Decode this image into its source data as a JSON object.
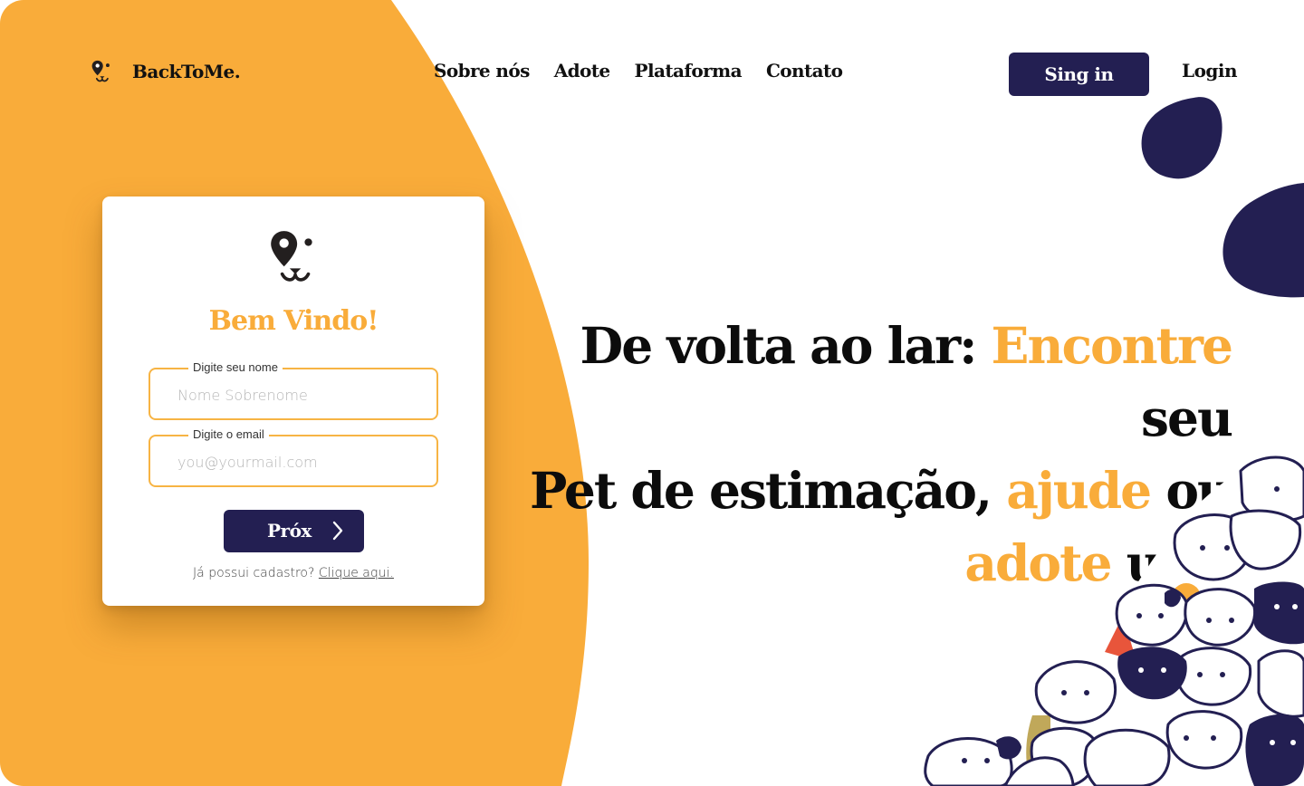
{
  "colors": {
    "accent": "#f9ac3a",
    "primary": "#231f52",
    "text": "#0c0c0c"
  },
  "header": {
    "brand": "BackToMe.",
    "logo_icon": "pet-face-pin-icon",
    "nav": [
      "Sobre nós",
      "Adote",
      "Plataforma",
      "Contato"
    ],
    "signin_label": "Sing in",
    "login_label": "Login"
  },
  "card": {
    "icon": "pet-face-pin-icon",
    "title": "Bem Vindo!",
    "name_field": {
      "label": "Digite seu nome",
      "placeholder": "Nome Sobrenome",
      "value": ""
    },
    "email_field": {
      "label": "Digite o email",
      "placeholder": "you@yourmail.com",
      "value": ""
    },
    "next_label": "Próx",
    "next_icon": "chevron-right-icon",
    "signup_text": "Já possui cadastro?",
    "signup_link": "Clique aqui."
  },
  "hero": {
    "l1a": "De volta ao lar: ",
    "l1b": "Encontre",
    "l1c": " seu",
    "l2a": "Pet de estimação, ",
    "l2b": "ajude",
    "l2c": " ou",
    "l3a": "adote",
    "l3b": " um!"
  },
  "illustration": "pets-pile-illustration"
}
